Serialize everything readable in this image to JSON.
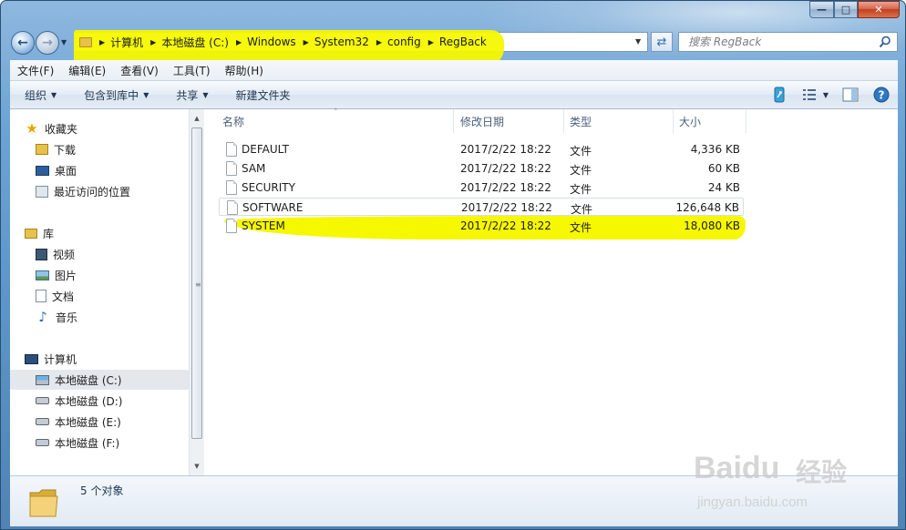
{
  "address": {
    "crumbs": [
      "计算机",
      "本地磁盘 (C:)",
      "Windows",
      "System32",
      "config",
      "RegBack"
    ]
  },
  "search": {
    "placeholder": "搜索 RegBack"
  },
  "menu": [
    "文件(F)",
    "编辑(E)",
    "查看(V)",
    "工具(T)",
    "帮助(H)"
  ],
  "toolbar": {
    "organize": "组织",
    "include_library": "包含到库中",
    "share": "共享",
    "new_folder": "新建文件夹"
  },
  "sidebar": {
    "favorites_header": "收藏夹",
    "favorites": [
      "下载",
      "桌面",
      "最近访问的位置"
    ],
    "libraries_header": "库",
    "libraries": [
      "视频",
      "图片",
      "文档",
      "音乐"
    ],
    "computer_header": "计算机",
    "drives": [
      "本地磁盘 (C:)",
      "本地磁盘 (D:)",
      "本地磁盘 (E:)",
      "本地磁盘 (F:)"
    ]
  },
  "columns": {
    "name": "名称",
    "date": "修改日期",
    "type": "类型",
    "size": "大小"
  },
  "files": [
    {
      "name": "DEFAULT",
      "date": "2017/2/22 18:22",
      "type": "文件",
      "size": "4,336 KB"
    },
    {
      "name": "SAM",
      "date": "2017/2/22 18:22",
      "type": "文件",
      "size": "60 KB"
    },
    {
      "name": "SECURITY",
      "date": "2017/2/22 18:22",
      "type": "文件",
      "size": "24 KB"
    },
    {
      "name": "SOFTWARE",
      "date": "2017/2/22 18:22",
      "type": "文件",
      "size": "126,648 KB"
    },
    {
      "name": "SYSTEM",
      "date": "2017/2/22 18:22",
      "type": "文件",
      "size": "18,080 KB"
    }
  ],
  "status": {
    "count_text": "5 个对象"
  },
  "watermark": {
    "brand": "Baidu",
    "tag": "经验",
    "url": "jingyan.baidu.com"
  },
  "colors": {
    "highlight": "#f6f800",
    "selection": "#e4e8ed",
    "chrome": "#6aa3d4"
  }
}
